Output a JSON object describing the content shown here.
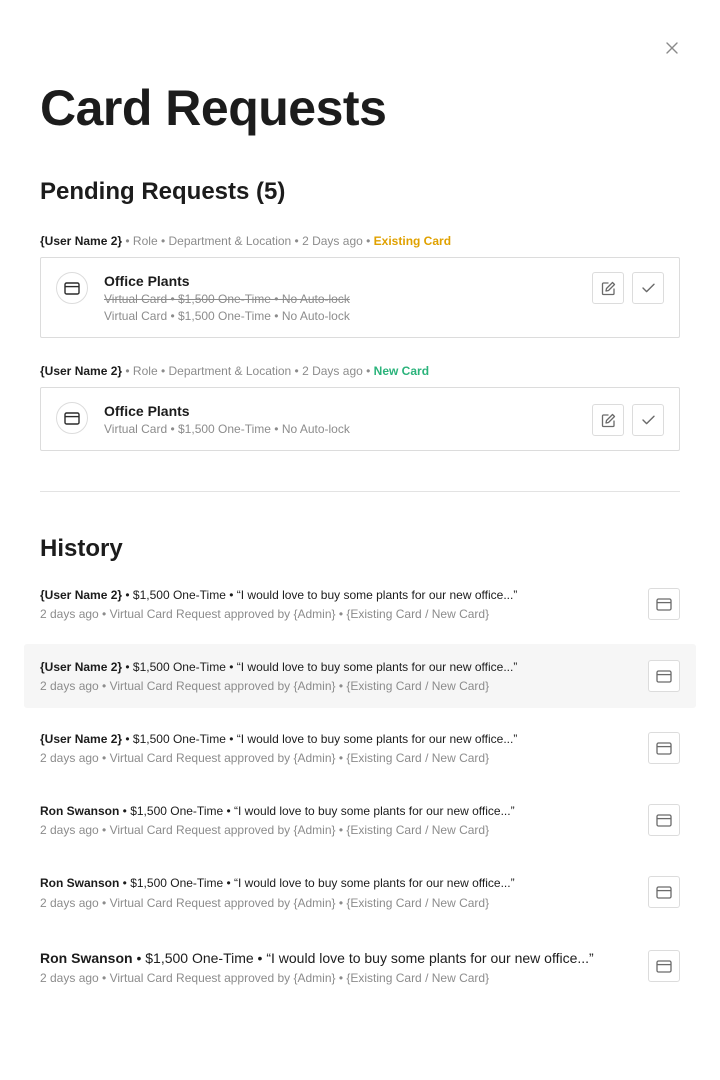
{
  "page": {
    "title": "Card Requests"
  },
  "pending": {
    "title": "Pending Requests (5)",
    "requests": [
      {
        "user": "{User Name 2}",
        "meta": " • Role • Department & Location • 2 Days ago • ",
        "tag": "Existing Card",
        "card_name": "Office Plants",
        "old_detail": "Virtual Card • $1,500 One-Time • No Auto-lock",
        "detail": "Virtual Card • $1,500 One-Time • No Auto-lock"
      },
      {
        "user": "{User Name 2}",
        "meta": " • Role • Department & Location • 2 Days ago • ",
        "tag": "New Card",
        "card_name": "Office Plants",
        "detail": "Virtual Card • $1,500 One-Time • No Auto-lock"
      }
    ]
  },
  "history": {
    "title": "History",
    "rows": [
      {
        "user": "{User Name 2}",
        "summary": " • $1,500 One-Time • “I would love to buy some plants for our new office...”",
        "status": "2 days ago • Virtual Card Request approved by {Admin} • {Existing Card / New Card}"
      },
      {
        "user": "{User Name 2}",
        "summary": " • $1,500 One-Time • “I would love to buy some plants for our new office...”",
        "status": "2 days ago • Virtual Card Request approved by {Admin} • {Existing Card / New Card}"
      },
      {
        "user": "{User Name 2}",
        "summary": " • $1,500 One-Time • “I would love to buy some plants for our new office...”",
        "status": "2 days ago • Virtual Card Request approved by {Admin} • {Existing Card / New Card}"
      },
      {
        "user": "Ron Swanson",
        "summary": " • $1,500 One-Time • “I would love to buy some plants for our new office...”",
        "status": "2 days ago • Virtual Card Request approved by {Admin} • {Existing Card / New Card}"
      },
      {
        "user": "Ron Swanson",
        "summary": " • $1,500 One-Time • “I would love to buy some plants for our new office...”",
        "status": "2 days ago • Virtual Card Request approved by {Admin} • {Existing Card / New Card}"
      },
      {
        "user": "Ron Swanson",
        "summary": " • $1,500 One-Time • “I would love to buy some plants for our new office...”",
        "status": "2 days ago • Virtual Card Request approved by {Admin} • {Existing Card / New Card}"
      }
    ]
  },
  "icons": {
    "close": "close-icon",
    "card": "credit-card-icon",
    "edit": "edit-icon",
    "approve": "check-icon"
  },
  "colors": {
    "existing_tag": "#e0a100",
    "new_tag": "#2bb37b",
    "highlight_row": "#f6f6f6"
  }
}
